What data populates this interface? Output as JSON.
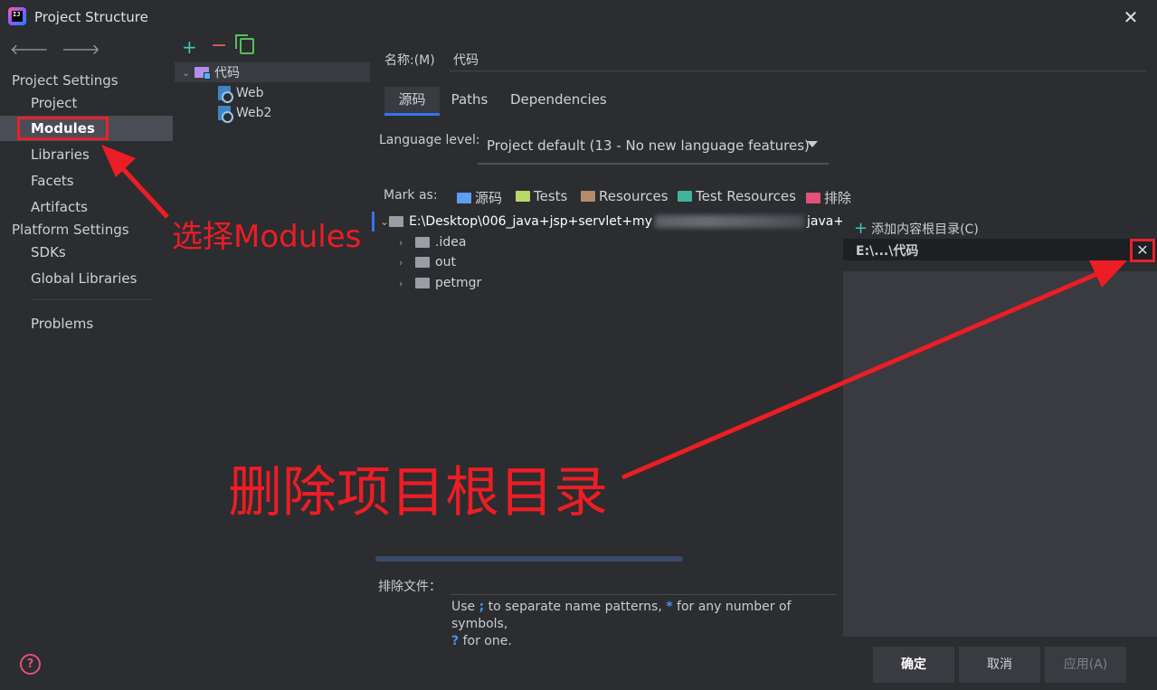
{
  "window": {
    "title": "Project Structure",
    "close_glyph": "✕"
  },
  "nav": {
    "back": "🡐",
    "forward": "🡒"
  },
  "sidebar": {
    "project_settings_title": "Project Settings",
    "platform_settings_title": "Platform Settings",
    "items": [
      {
        "label": "Project"
      },
      {
        "label": "Modules"
      },
      {
        "label": "Libraries"
      },
      {
        "label": "Facets"
      },
      {
        "label": "Artifacts"
      },
      {
        "label": "SDKs"
      },
      {
        "label": "Global Libraries"
      },
      {
        "label": "Problems"
      }
    ]
  },
  "modules": {
    "toolbar": {
      "add": "+",
      "remove": "−"
    },
    "tree": [
      {
        "label": "代码"
      },
      {
        "label": "Web"
      },
      {
        "label": "Web2"
      }
    ]
  },
  "module": {
    "name_label": "名称:(M)",
    "name_value": "代码",
    "tabs": [
      {
        "label": "源码"
      },
      {
        "label": "Paths"
      },
      {
        "label": "Dependencies"
      }
    ],
    "language_level_label": "Language level:",
    "language_level_value": "Project default (13 - No new language features)",
    "mark_as_label": "Mark as:",
    "mark_as": [
      {
        "label": "源码",
        "color": "#5f9cf2"
      },
      {
        "label": "Tests",
        "color": "#7fc24f"
      },
      {
        "label": "Resources",
        "color": "#b48a6c"
      },
      {
        "label": "Test Resources",
        "color": "#3fb39c"
      },
      {
        "label": "排除",
        "color": "#e0527a"
      }
    ],
    "root_path_prefix": "E:\\Desktop\\006_java+jsp+servlet+my",
    "root_path_suffix": "java+jsp",
    "folders": [
      {
        "label": ".idea"
      },
      {
        "label": "out"
      },
      {
        "label": "petmgr"
      }
    ],
    "add_content_root": "添加内容根目录(C)",
    "content_root": "E:\\...\\代码",
    "remove_root_glyph": "✕",
    "exclude_label": "排除文件：",
    "hint_line1_a": "Use ",
    "hint_semicolon": ";",
    "hint_line1_b": " to separate name patterns, ",
    "hint_star": "*",
    "hint_line1_c": " for any number of symbols,",
    "hint_q": "?",
    "hint_line2": " for one."
  },
  "footer": {
    "help": "?",
    "ok": "确定",
    "cancel": "取消",
    "apply": "应用(A)"
  },
  "annotations": {
    "select_modules": "选择Modules",
    "delete_root": "删除项目根目录"
  }
}
